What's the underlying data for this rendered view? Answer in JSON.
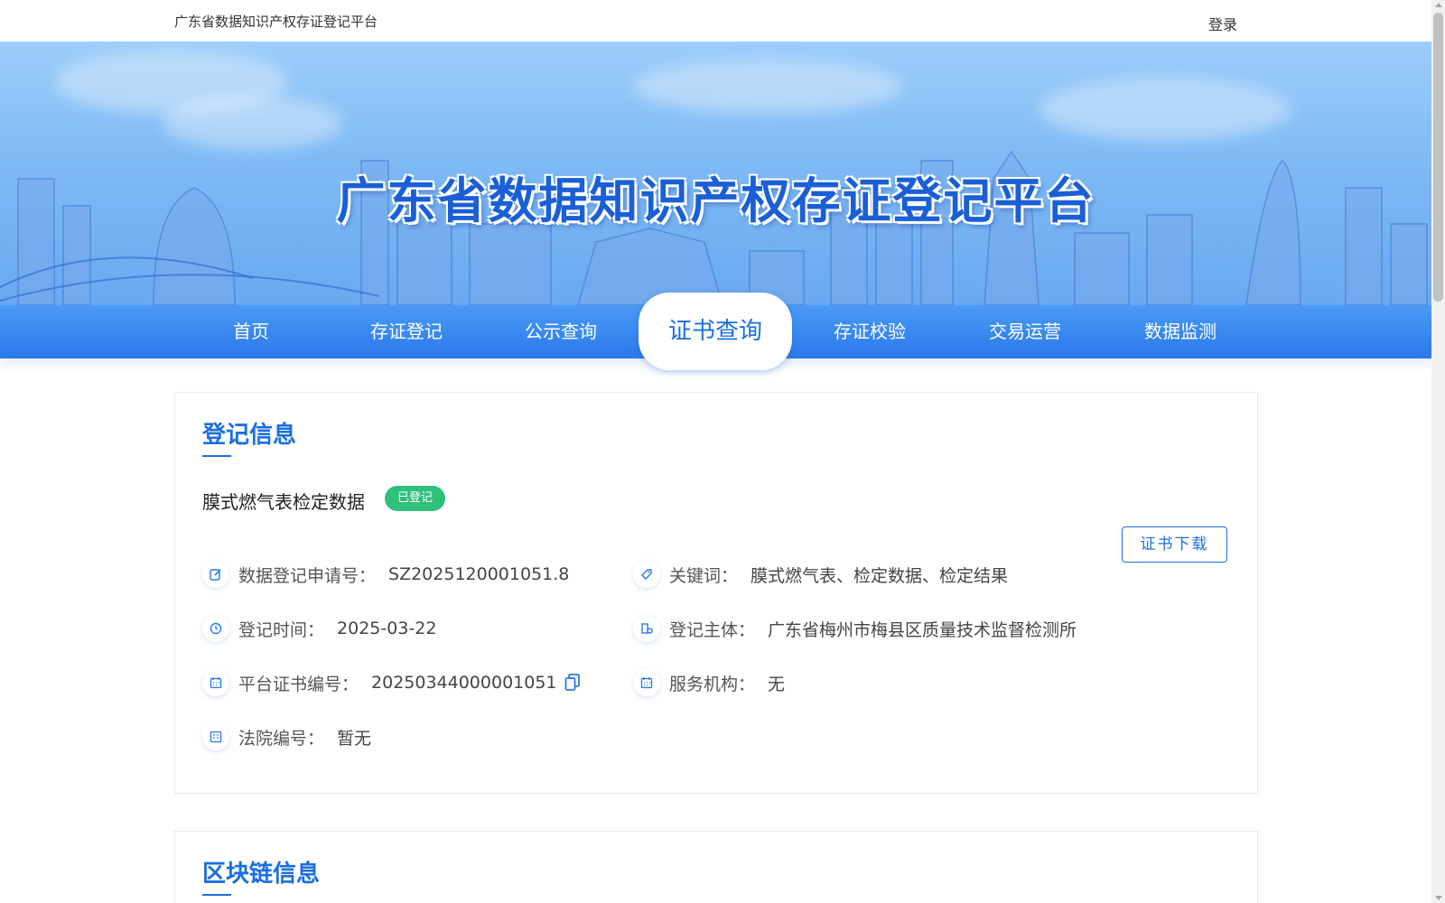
{
  "topbar": {
    "site_name": "广东省数据知识产权存证登记平台",
    "login": "登录"
  },
  "banner": {
    "title": "广东省数据知识产权存证登记平台"
  },
  "nav": {
    "items": [
      "首页",
      "存证登记",
      "公示查询",
      "证书查询",
      "存证校验",
      "交易运营",
      "数据监测"
    ],
    "active": "证书查询"
  },
  "registration": {
    "section_title": "登记信息",
    "data_name": "膜式燃气表检定数据",
    "status": "已登记",
    "download_button": "证书下载",
    "fields": {
      "application_no": {
        "label": "数据登记申请号：",
        "value": "SZ2025120001051.8"
      },
      "keywords": {
        "label": "关键词：",
        "value": "膜式燃气表、检定数据、检定结果"
      },
      "reg_time": {
        "label": "登记时间：",
        "value": "2025-03-22"
      },
      "reg_subject": {
        "label": "登记主体：",
        "value": "广东省梅州市梅县区质量技术监督检测所"
      },
      "cert_no": {
        "label": "平台证书编号：",
        "value": "20250344000001051"
      },
      "service_org": {
        "label": "服务机构：",
        "value": "无"
      },
      "court_no": {
        "label": "法院编号：",
        "value": "暂无"
      }
    }
  },
  "blockchain": {
    "section_title": "区块链信息"
  },
  "colors": {
    "accent": "#1a6fe0",
    "badge": "#2fc07c",
    "nav": "#2a78ea"
  },
  "icons": [
    "edit-icon",
    "tag-icon",
    "clock-icon",
    "building-icon",
    "calendar-icon",
    "calendar-icon",
    "list-icon",
    "copy-icon"
  ]
}
